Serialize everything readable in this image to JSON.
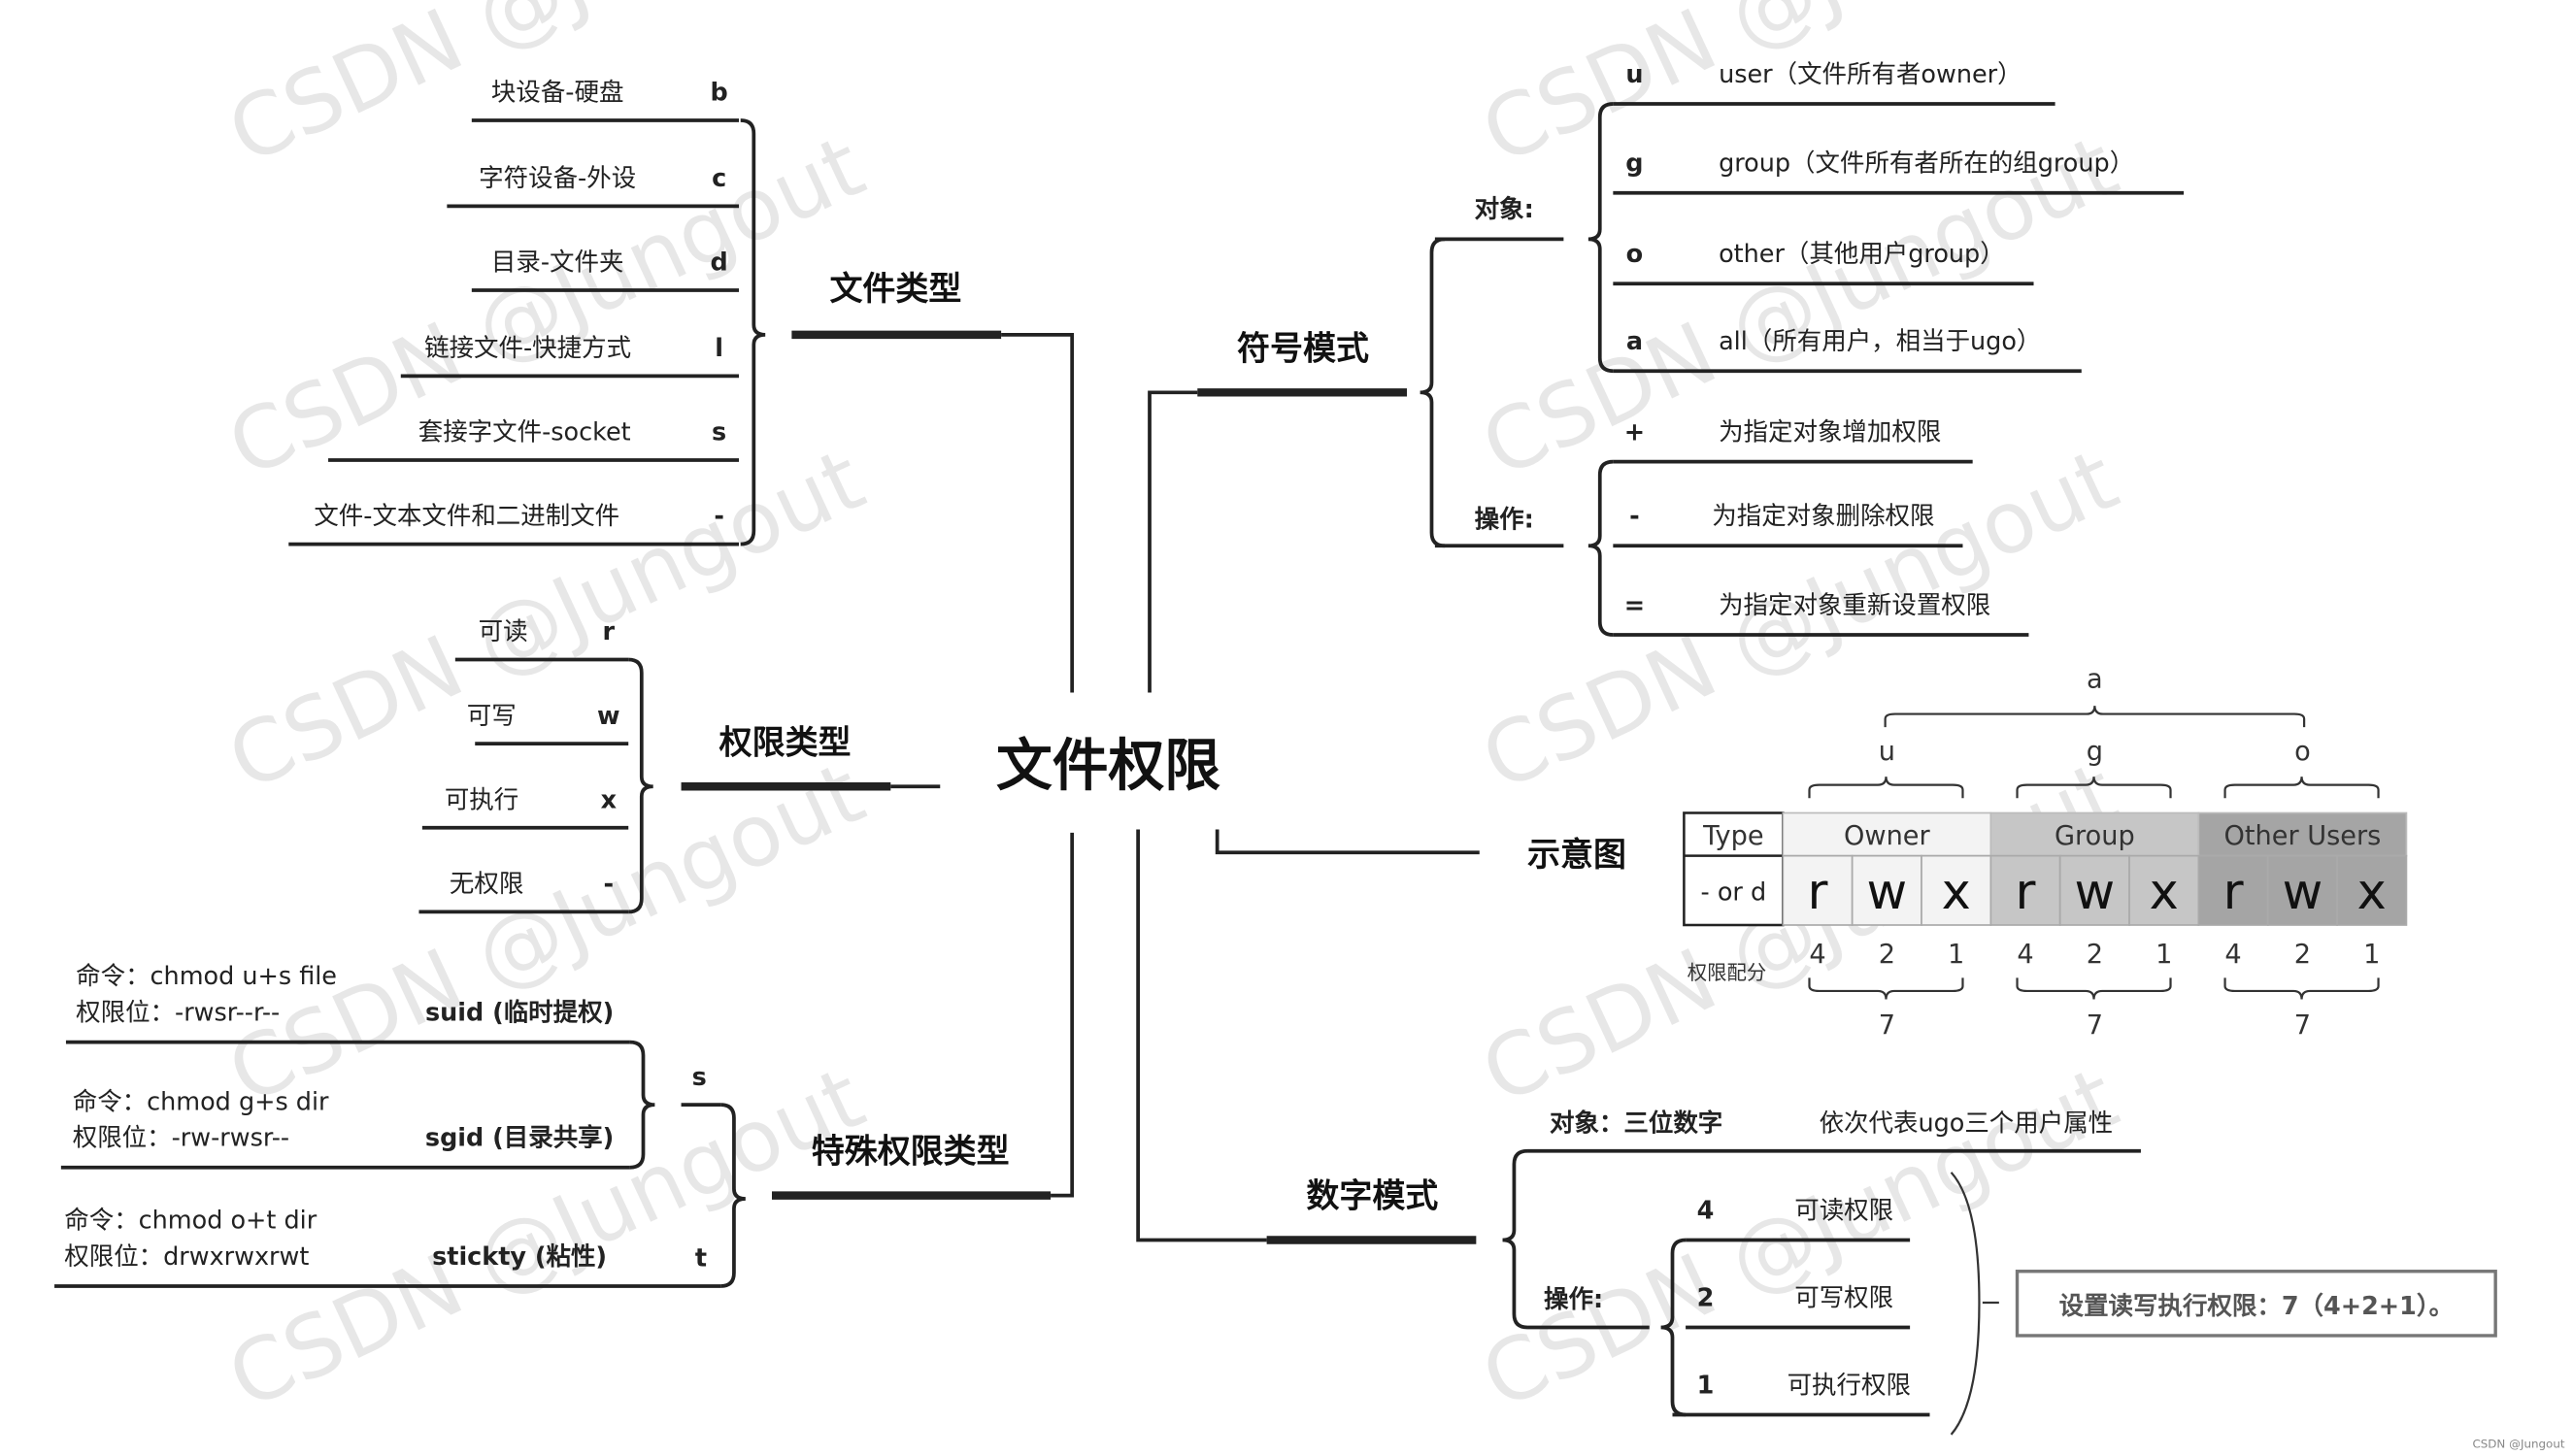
{
  "center": "文件权限",
  "file_types": {
    "title": "文件类型",
    "items": [
      {
        "label": "块设备-硬盘",
        "code": "b"
      },
      {
        "label": "字符设备-外设",
        "code": "c"
      },
      {
        "label": "目录-文件夹",
        "code": "d"
      },
      {
        "label": "链接文件-快捷方式",
        "code": "l"
      },
      {
        "label": "套接字文件-socket",
        "code": "s"
      },
      {
        "label": "文件-文本文件和二进制文件",
        "code": "-"
      }
    ]
  },
  "perm_types": {
    "title": "权限类型",
    "items": [
      {
        "label": "可读",
        "code": "r"
      },
      {
        "label": "可写",
        "code": "w"
      },
      {
        "label": "可执行",
        "code": "x"
      },
      {
        "label": "无权限",
        "code": "-"
      }
    ]
  },
  "special": {
    "title": "特殊权限类型",
    "s_label": "s",
    "items": [
      {
        "cmd": "命令：chmod u+s file",
        "bits": "权限位：-rwsr--r--",
        "name": "suid (临时提权)",
        "code": ""
      },
      {
        "cmd": "命令：chmod g+s dir",
        "bits": "权限位：-rw-rwsr--",
        "name": "sgid (目录共享)",
        "code": ""
      },
      {
        "cmd": "命令：chmod o+t dir",
        "bits": "权限位：drwxrwxrwt",
        "name": "stickty (粘性)",
        "code": "t"
      }
    ]
  },
  "symbolic": {
    "title": "符号模式",
    "objects_label": "对象:",
    "objects": [
      {
        "code": "u",
        "desc": "user（文件所有者owner）"
      },
      {
        "code": "g",
        "desc": "group（文件所有者所在的组group）"
      },
      {
        "code": "o",
        "desc": "other（其他用户group）"
      },
      {
        "code": "a",
        "desc": "all（所有用户，相当于ugo）"
      }
    ],
    "ops_label": "操作:",
    "ops": [
      {
        "code": "+",
        "desc": "为指定对象增加权限"
      },
      {
        "code": "-",
        "desc": "为指定对象删除权限"
      },
      {
        "code": "=",
        "desc": "为指定对象重新设置权限"
      }
    ]
  },
  "diagram": {
    "title": "示意图",
    "all_label": "a",
    "group_labels": [
      "u",
      "g",
      "o"
    ],
    "type_header": "Type",
    "type_value": "- or d",
    "headers": [
      "Owner",
      "Group",
      "Other Users"
    ],
    "bits": [
      "r",
      "w",
      "x"
    ],
    "weights_label": "权限配分",
    "weights": [
      "4",
      "2",
      "1"
    ],
    "sums": [
      "7",
      "7",
      "7"
    ],
    "colors": [
      "#f3f3f3",
      "#c6c6c6",
      "#a5a5a5"
    ]
  },
  "numeric": {
    "title": "数字模式",
    "objects_label": "对象：三位数字",
    "objects_desc": "依次代表ugo三个用户属性",
    "ops_label": "操作:",
    "ops": [
      {
        "code": "4",
        "desc": "可读权限"
      },
      {
        "code": "2",
        "desc": "可写权限"
      },
      {
        "code": "1",
        "desc": "可执行权限"
      }
    ],
    "summary": "设置读写执行权限：7（4+2+1）。"
  },
  "watermark": "CSDN @Jungout",
  "footer": "CSDN @Jungout"
}
